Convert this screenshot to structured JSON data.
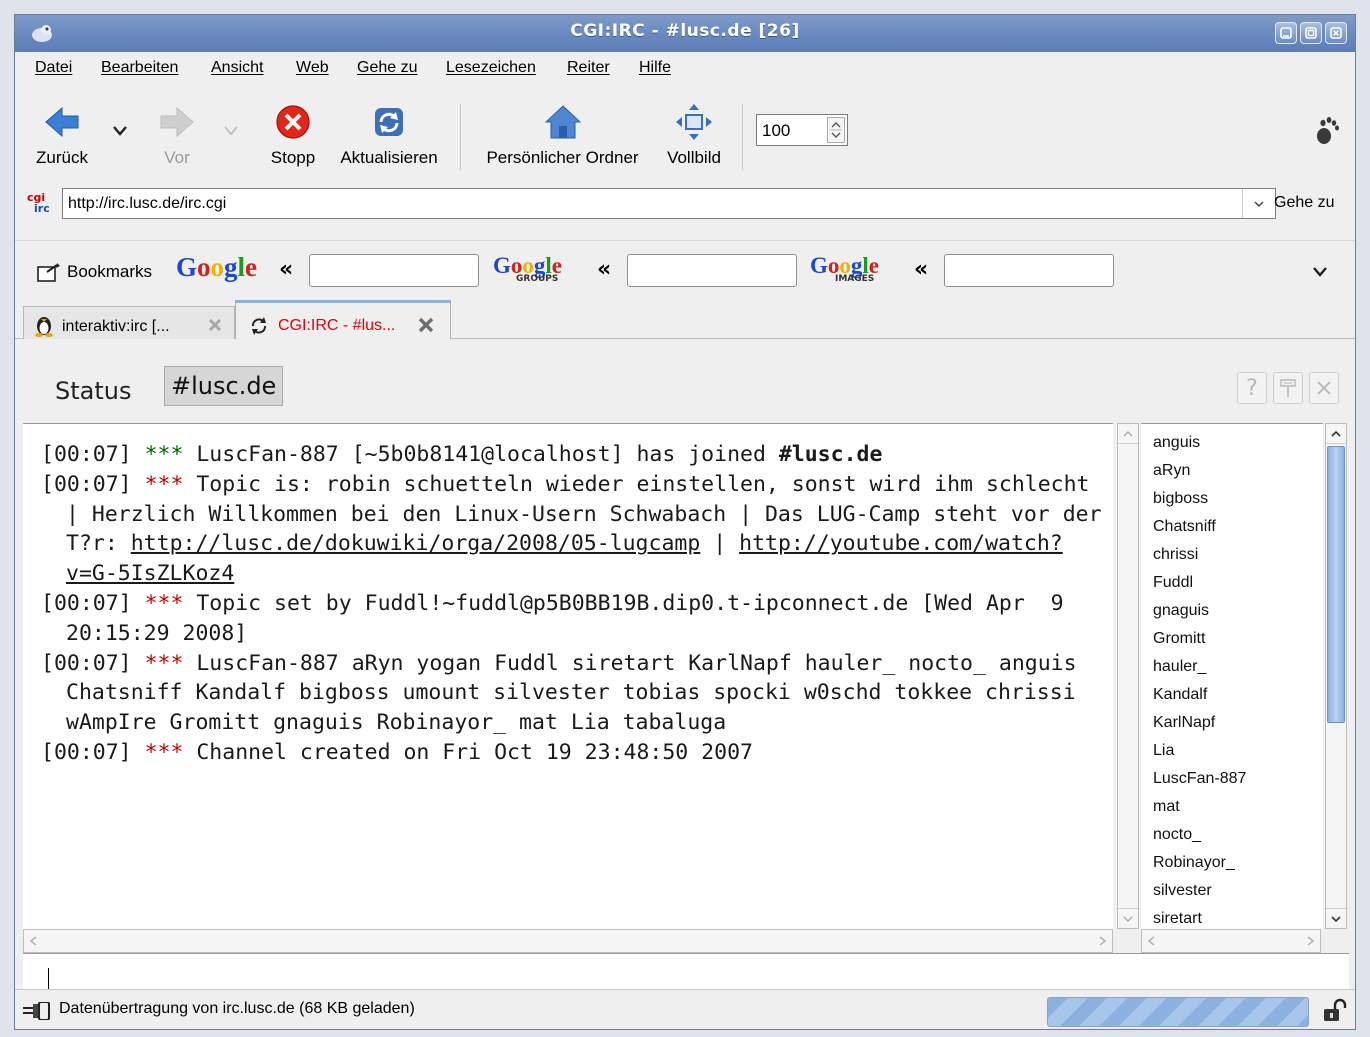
{
  "window": {
    "title": "CGI:IRC - #lusc.de [26]"
  },
  "menu": [
    "Datei",
    "Bearbeiten",
    "Ansicht",
    "Web",
    "Gehe zu",
    "Lesezeichen",
    "Reiter",
    "Hilfe"
  ],
  "toolbar": {
    "back_label": "Zurück",
    "forward_label": "Vor",
    "stop_label": "Stopp",
    "reload_label": "Aktualisieren",
    "home_label": "Persönlicher Ordner",
    "fullscreen_label": "Vollbild",
    "zoom_value": "100"
  },
  "location": {
    "site_icon_text_top": "cgi",
    "site_icon_text_bottom": "irc",
    "url": "http://irc.lusc.de/irc.cgi",
    "go_label": "Gehe zu"
  },
  "bookmarks": {
    "label": "Bookmarks",
    "google": "Google",
    "google_groups": "Google",
    "groups_sub": "GROUPS",
    "google_images": "Google",
    "images_sub": "IMAGES",
    "raquo": "«"
  },
  "tabs": [
    {
      "label": "interaktiv:irc [..."
    },
    {
      "label": "CGI:IRC - #lus..."
    }
  ],
  "irc": {
    "status_tab": "Status",
    "channel_tab": "#lusc.de",
    "lines": [
      {
        "time": "[00:07]",
        "stars": "***",
        "text": "LuscFan-887 [~5b0b8141@localhost] has joined ",
        "bold": "#lusc.de"
      },
      {
        "time": "[00:07]",
        "stars": "***",
        "text": "Topic is: robin schuetteln wieder einstellen, sonst wird ihm schlecht | Herzlich Willkommen bei den Linux-Usern Schwabach | Das LUG-Camp steht vor der T?r: ",
        "link1": "http://lusc.de/dokuwiki/orga/2008/05-lugcamp",
        "sep": " | ",
        "link2": "http://youtube.com/watch?v=G-5IsZLKoz4"
      },
      {
        "time": "[00:07]",
        "stars": "***",
        "text": "Topic set by Fuddl!~fuddl@p5B0BB19B.dip0.t-ipconnect.de [Wed Apr  9 20:15:29 2008]"
      },
      {
        "time": "[00:07]",
        "stars": "***",
        "text": "LuscFan-887 aRyn yogan Fuddl siretart KarlNapf hauler_ nocto_ anguis Chatsniff Kandalf bigboss umount silvester tobias spocki w0schd tokkee chrissi wAmpIre Gromitt gnaguis Robinayor_ mat Lia tabaluga"
      },
      {
        "time": "[00:07]",
        "stars": "***",
        "text": "Channel created on Fri Oct 19 23:48:50 2007"
      }
    ],
    "nicks": [
      "anguis",
      "aRyn",
      "bigboss",
      "Chatsniff",
      "chrissi",
      "Fuddl",
      "gnaguis",
      "Gromitt",
      "hauler_",
      "Kandalf",
      "KarlNapf",
      "Lia",
      "LuscFan-887",
      "mat",
      "nocto_",
      "Robinayor_",
      "silvester",
      "siretart"
    ]
  },
  "statusbar": {
    "text": "Datenübertragung von irc.lusc.de (68 KB geladen)"
  },
  "colors": {
    "titlebar": "#6b8ac0",
    "tab_active_text": "#e1000b",
    "stars": "#c00000",
    "join": "#006400"
  }
}
